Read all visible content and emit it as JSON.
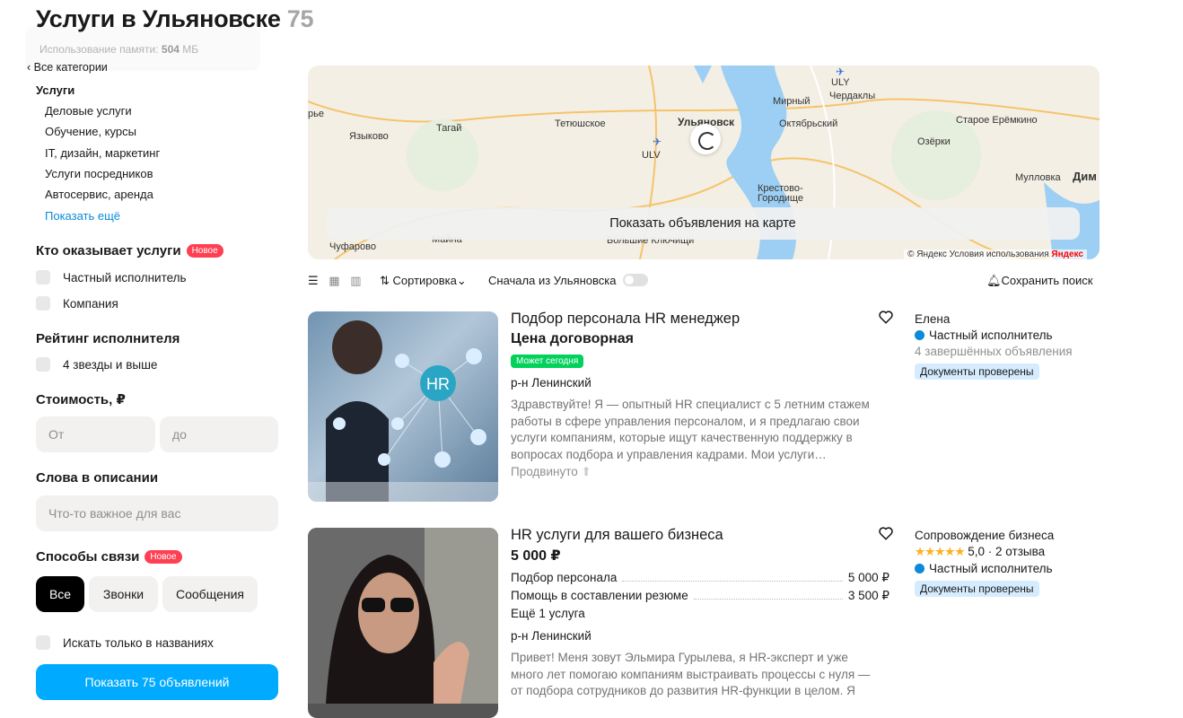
{
  "memory": {
    "label": "Использование памяти:",
    "value": "504",
    "unit": "МБ"
  },
  "title": "Услуги в Ульяновске",
  "count": "75",
  "sidebar": {
    "back": "Все категории",
    "category": "Услуги",
    "subcategories": [
      "Деловые услуги",
      "Обучение, курсы",
      "IT, дизайн, маркетинг",
      "Услуги посредников",
      "Автосервис, аренда"
    ],
    "show_more": "Показать ещё",
    "provider_title": "Кто оказывает услуги",
    "new_badge": "Новое",
    "provider_options": [
      "Частный исполнитель",
      "Компания"
    ],
    "rating_title": "Рейтинг исполнителя",
    "rating_option": "4 звезды и выше",
    "cost_title": "Стоимость, ₽",
    "cost_from": "От",
    "cost_to": "до",
    "words_title": "Слова в описании",
    "words_placeholder": "Что-то важное для вас",
    "contact_title": "Способы связи",
    "contact_options": [
      "Все",
      "Звонки",
      "Сообщения"
    ],
    "titles_only": "Искать только в названиях",
    "show_button": "Показать 75 объявлений"
  },
  "map": {
    "labels": [
      "рье",
      "Языково",
      "Тагай",
      "Тетюшское",
      "ULV",
      "Ульяновск",
      "ULY",
      "Мирный",
      "Чердаклы",
      "Октябрьский",
      "Старое Ерёмкино",
      "Озёрки",
      "Крестово-",
      "Городище",
      "Мулловка",
      "Дим",
      "Чуфарово",
      "Майна",
      "Большие Ключищи"
    ],
    "button": "Показать объявления на карте",
    "copyright": "© Яндекс Условия использования",
    "brand": "Яндекс"
  },
  "toolbar": {
    "sort": "Сортировка",
    "from_city": "Сначала из Ульяновска",
    "save_search": "Сохранить поиск"
  },
  "listings": [
    {
      "title": "Подбор персонала HR менеджер",
      "price": "Цена договорная",
      "badge": "Может сегодня",
      "district": "р-н Ленинский",
      "description": "Здравствуйте! Я — опытный HR специалист с 5 летним стажем работы в сфере управления персоналом, и я предлагаю свои услуги компаниям, которые ищут качественную поддержку в вопросах подбора и управления кадрами. Мои услуги…",
      "promoted": "Продвинуто",
      "photo_text": "HR",
      "seller": {
        "name": "Елена",
        "type": "Частный исполнитель",
        "stats": "4 завершённых объявления",
        "docs": "Документы проверены"
      }
    },
    {
      "title": "HR услуги для вашего бизнеса",
      "price": "5 000 ₽",
      "services": [
        {
          "name": "Подбор персонала",
          "price": "5 000 ₽"
        },
        {
          "name": "Помощь в составлении резюме",
          "price": "3 500 ₽"
        }
      ],
      "more_services": "Ещё 1 услуга",
      "district": "р-н Ленинский",
      "description": "Привет! Меня зовут Эльмира Гурылева, я HR-эксперт и уже много лет помогаю компаниям выстраивать процессы с нуля — от подбора сотрудников до развития HR-функции в целом. Я",
      "seller": {
        "name": "Сопровождение бизнеса",
        "stars": "★★★★★",
        "rating": "5,0 · 2 отзыва",
        "type": "Частный исполнитель",
        "docs": "Документы проверены"
      }
    }
  ]
}
